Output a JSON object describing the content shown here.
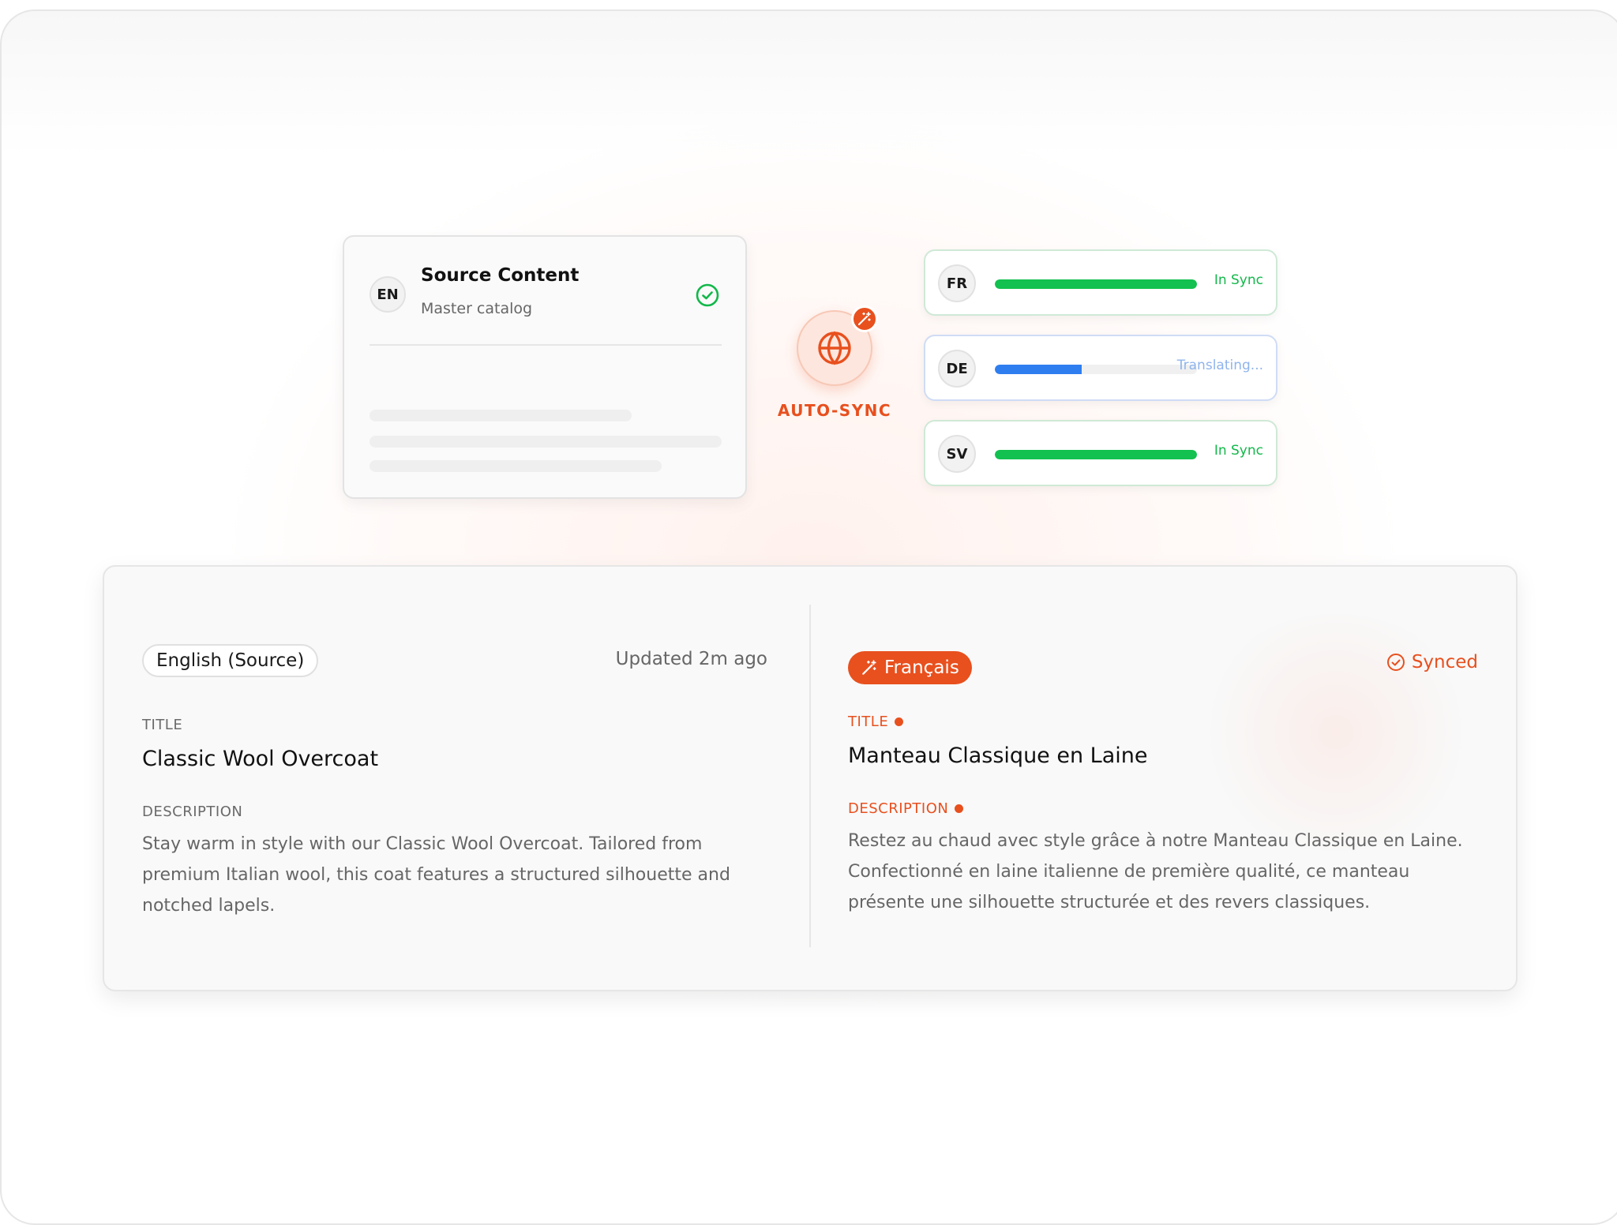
{
  "source": {
    "lang_code": "EN",
    "title": "Source Content",
    "subtitle": "Master catalog"
  },
  "hub": {
    "label": "AUTO-SYNC"
  },
  "targets": [
    {
      "lang_code": "FR",
      "status": "In Sync",
      "progress": 1.0
    },
    {
      "lang_code": "DE",
      "status": "Translating...",
      "progress": 0.43
    },
    {
      "lang_code": "SV",
      "status": "In Sync",
      "progress": 1.0
    }
  ],
  "editor": {
    "left": {
      "language_pill": "English (Source)",
      "updated": "Updated 2m ago",
      "title_label": "TITLE",
      "title_value": "Classic Wool Overcoat",
      "description_label": "DESCRIPTION",
      "description_value": "Stay warm in style with our Classic Wool Overcoat. Tailored from premium Italian wool, this coat features a structured silhouette and notched lapels."
    },
    "right": {
      "language_pill": "Français",
      "status": "Synced",
      "title_label": "TITLE",
      "title_value": "Manteau Classique en Laine",
      "description_label": "DESCRIPTION",
      "description_value": "Restez au chaud avec style grâce à notre Manteau Classique en Laine. Confectionné en laine italienne de première qualité, ce manteau présente une silhouette structurée et des revers classiques."
    }
  },
  "colors": {
    "accent": "#e8501e",
    "in_sync": "#12c14f",
    "translating": "#2f7ef0"
  },
  "icons": {
    "source_status": "check-circle-icon",
    "hub": "globe-icon",
    "hub_badge": "magic-wand-icon",
    "synced": "check-circle-icon"
  }
}
